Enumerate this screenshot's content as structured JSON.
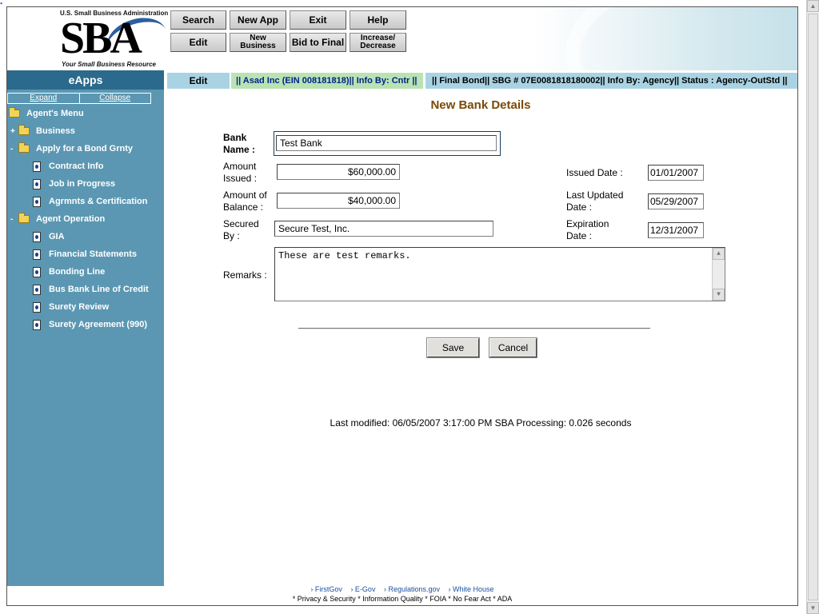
{
  "logo": {
    "agency": "U.S. Small Business Administration",
    "mark": "SBA",
    "tagline": "Your Small Business Resource"
  },
  "nav": {
    "row1": [
      "Search",
      "New App",
      "Exit",
      "Help"
    ],
    "row2": [
      "Edit",
      "New Business",
      "Bid to Final",
      "Increase/ Decrease"
    ]
  },
  "statusbar": {
    "app_name": "eApps",
    "mode": "Edit",
    "applicant": "|| Asad Inc (EIN 008181818)|| Info By:  Cntr ||",
    "bond": "|| Final Bond|| SBG # 07E0081818180002|| Info By:  Agency|| Status :  Agency-OutStd ||"
  },
  "sidebar": {
    "expand": "Expand",
    "collapse": "Collapse",
    "items": [
      {
        "label": "Agent's Menu",
        "type": "folder-open",
        "toggle": ""
      },
      {
        "label": "Business",
        "type": "folder",
        "toggle": "+"
      },
      {
        "label": "Apply for a Bond Grnty",
        "type": "folder-open",
        "toggle": "-"
      },
      {
        "label": "Contract Info",
        "type": "page",
        "toggle": ""
      },
      {
        "label": "Job in Progress",
        "type": "page",
        "toggle": ""
      },
      {
        "label": "Agrmnts & Certification",
        "type": "page",
        "toggle": ""
      },
      {
        "label": "Agent Operation",
        "type": "folder-open",
        "toggle": "-"
      },
      {
        "label": "GIA",
        "type": "page",
        "toggle": ""
      },
      {
        "label": "Financial Statements",
        "type": "page",
        "toggle": ""
      },
      {
        "label": "Bonding Line",
        "type": "page",
        "toggle": ""
      },
      {
        "label": "Bus Bank Line of Credit",
        "type": "page",
        "toggle": ""
      },
      {
        "label": "Surety Review",
        "type": "page",
        "toggle": ""
      },
      {
        "label": "Surety Agreement (990)",
        "type": "page",
        "toggle": ""
      }
    ]
  },
  "form": {
    "title": "New Bank Details",
    "bank_name_label": "Bank Name :",
    "bank_name": "Test Bank",
    "amount_issued_label": "Amount Issued :",
    "amount_issued": "$60,000.00",
    "amount_balance_label": "Amount of Balance :",
    "amount_balance": "$40,000.00",
    "secured_by_label": "Secured By :",
    "secured_by": "Secure Test, Inc.",
    "issued_date_label": "Issued Date :",
    "issued_date": "01/01/2007",
    "last_updated_label": "Last Updated Date :",
    "last_updated": "05/29/2007",
    "expiration_label": "Expiration Date :",
    "expiration": "12/31/2007",
    "remarks_label": "Remarks :",
    "remarks": "These are test remarks.",
    "save": "Save",
    "cancel": "Cancel"
  },
  "last_modified": "Last modified: 06/05/2007 3:17:00 PM   SBA Processing:  0.026 seconds",
  "footer": {
    "links": [
      "› FirstGov",
      "› E-Gov",
      "› Regulations.gov",
      "› White House"
    ],
    "bottom": "* Privacy & Security  * Information Quality  * FOIA  * No Fear Act  * ADA"
  }
}
